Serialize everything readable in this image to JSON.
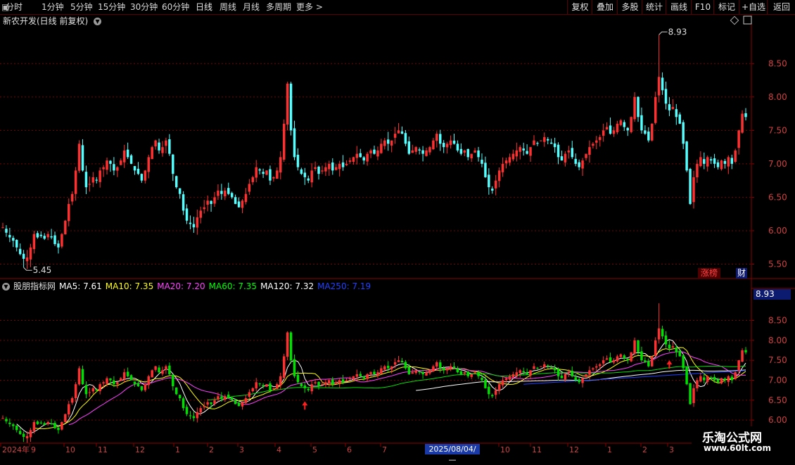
{
  "toolbar": {
    "left": [
      "分时",
      "1分钟",
      "5分钟",
      "15分钟",
      "30分钟",
      "60分钟",
      "日线",
      "周线",
      "月线",
      "多周期",
      "更多 >"
    ],
    "active_index": 6,
    "right": [
      "复权",
      "叠加",
      "多股",
      "统计",
      "画线",
      "F10",
      "标记",
      "+自选",
      "返回"
    ]
  },
  "main_title": "新农开发(日线 前复权)",
  "indicator": {
    "name": "股朋指标网",
    "ma": [
      {
        "label": "MA5: 7.61",
        "color": "#ffffff"
      },
      {
        "label": "MA10: 7.35",
        "color": "#ffff00"
      },
      {
        "label": "MA20: 7.20",
        "color": "#ff40ff"
      },
      {
        "label": "MA60: 7.35",
        "color": "#00ff00"
      },
      {
        "label": "MA120: 7.32",
        "color": "#ffffff"
      },
      {
        "label": "MA250: 7.19",
        "color": "#2040ff"
      }
    ]
  },
  "badges": {
    "zhangbang": "涨榜",
    "cai": "财"
  },
  "price_box": "8.93",
  "date_box": "2025/08/04/—",
  "watermark": {
    "line1": "乐淘公式网",
    "line2": "www.60lt.com"
  },
  "colors": {
    "up": "#ff3030",
    "down": "#54ffff",
    "down2": "#00e000",
    "grid": "#7a0000"
  },
  "chart_data": {
    "type": "candlestick",
    "main": {
      "y_ticks": [
        "8.50",
        "8.00",
        "7.50",
        "7.00",
        "6.50",
        "6.00",
        "5.50"
      ],
      "ylim": [
        5.4,
        9.05
      ],
      "high_label": "8.93",
      "low_label": "5.45",
      "closes": [
        6.05,
        5.97,
        5.9,
        5.85,
        5.75,
        5.65,
        5.58,
        5.6,
        5.75,
        5.95,
        5.9,
        5.92,
        5.88,
        5.95,
        5.9,
        5.8,
        5.75,
        5.95,
        6.15,
        6.4,
        6.55,
        6.9,
        7.3,
        6.9,
        6.65,
        6.7,
        6.8,
        6.75,
        6.9,
        6.95,
        7.05,
        7.0,
        6.9,
        6.95,
        7.05,
        7.2,
        7.1,
        7.0,
        6.9,
        6.85,
        6.75,
        6.9,
        7.1,
        7.25,
        7.35,
        7.2,
        7.25,
        7.35,
        7.15,
        6.85,
        6.65,
        6.55,
        6.3,
        6.15,
        6.1,
        6.05,
        6.2,
        6.3,
        6.35,
        6.45,
        6.4,
        6.5,
        6.6,
        6.55,
        6.6,
        6.55,
        6.5,
        6.4,
        6.35,
        6.45,
        6.55,
        6.7,
        6.8,
        6.95,
        6.9,
        6.85,
        6.9,
        6.75,
        6.8,
        6.9,
        7.1,
        7.6,
        8.2,
        7.5,
        7.1,
        6.95,
        6.85,
        6.8,
        6.75,
        6.9,
        6.95,
        6.85,
        6.9,
        6.95,
        7.0,
        6.9,
        6.95,
        7.0,
        6.95,
        7.0,
        7.05,
        7.1,
        7.15,
        7.1,
        7.05,
        7.15,
        7.2,
        7.15,
        7.2,
        7.3,
        7.35,
        7.3,
        7.35,
        7.45,
        7.5,
        7.45,
        7.3,
        7.15,
        7.2,
        7.25,
        7.2,
        7.15,
        7.2,
        7.25,
        7.35,
        7.45,
        7.3,
        7.25,
        7.3,
        7.35,
        7.3,
        7.2,
        7.15,
        7.2,
        7.1,
        7.15,
        7.2,
        7.1,
        7.0,
        6.8,
        6.65,
        6.6,
        6.75,
        6.9,
        7.0,
        7.05,
        7.1,
        7.15,
        7.2,
        7.25,
        7.2,
        7.15,
        7.25,
        7.35,
        7.3,
        7.35,
        7.4,
        7.35,
        7.3,
        7.25,
        7.1,
        7.05,
        7.15,
        7.2,
        7.1,
        7.0,
        6.95,
        7.05,
        7.15,
        7.25,
        7.3,
        7.35,
        7.4,
        7.5,
        7.55,
        7.45,
        7.5,
        7.6,
        7.65,
        7.55,
        7.5,
        7.7,
        8.0,
        7.7,
        7.5,
        7.45,
        7.35,
        7.6,
        8.0,
        8.3,
        8.1,
        7.9,
        7.8,
        7.85,
        7.7,
        7.6,
        7.3,
        6.9,
        6.4,
        6.8,
        7.0,
        7.1,
        7.0,
        7.1,
        7.05,
        7.0,
        6.95,
        7.05,
        7.0,
        7.1,
        7.0,
        7.2,
        7.5,
        7.75,
        7.7
      ]
    },
    "sub": {
      "y_ticks": [
        "8.50",
        "8.00",
        "7.50",
        "7.00",
        "6.50",
        "6.00"
      ],
      "ylim": [
        5.95,
        8.95
      ],
      "markers": "red arrows at the two low points"
    },
    "x_ticks": [
      "2024年",
      "9",
      "10",
      "11",
      "12",
      "1",
      "2",
      "3",
      "4",
      "5",
      "6",
      "7",
      "8",
      "9",
      "10",
      "11",
      "12",
      "1",
      "2",
      "3"
    ]
  }
}
